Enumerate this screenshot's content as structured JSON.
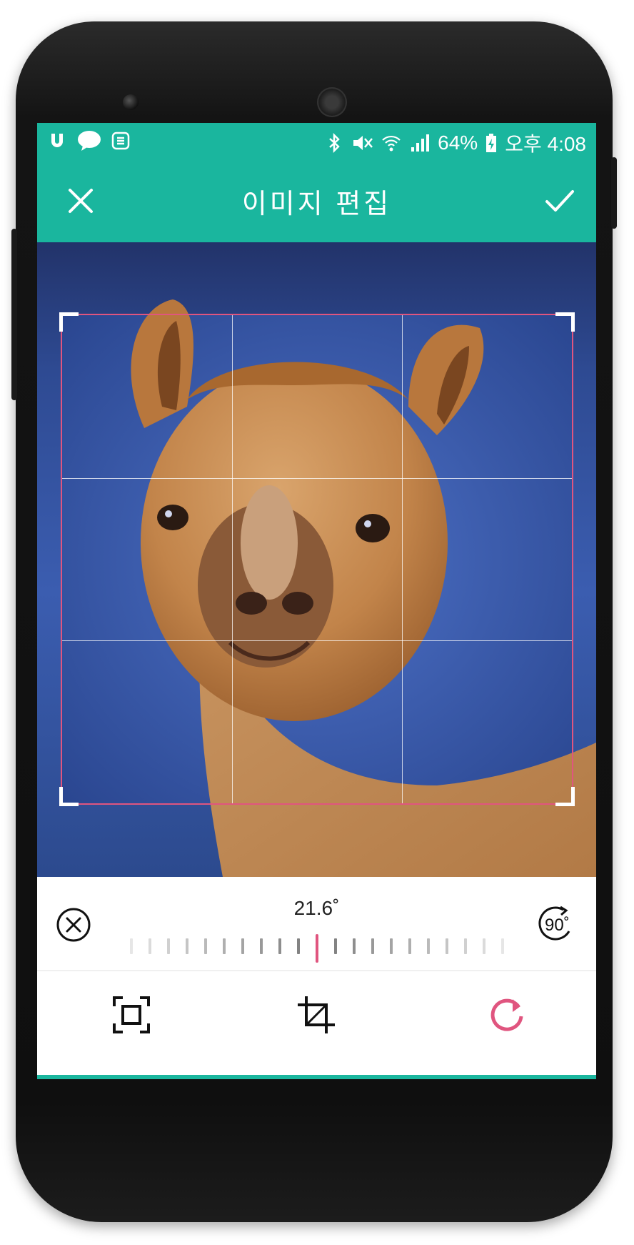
{
  "status_bar": {
    "left_icons": [
      "uplus-icon",
      "kakaotalk-icon",
      "notification-list-icon"
    ],
    "kakaotalk_label": "TALK",
    "right_icons": [
      "bluetooth-icon",
      "mute-icon",
      "wifi-icon",
      "signal-icon"
    ],
    "battery": "64%",
    "time": "오후 4:08"
  },
  "app_bar": {
    "title": "이미지 편집",
    "close_icon": "close-icon",
    "confirm_icon": "check-icon"
  },
  "editor": {
    "image_subject": "alpaca photo",
    "crop_grid": "3x3"
  },
  "rotation": {
    "angle_label": "21.6˚",
    "angle": 21.6,
    "reset_icon": "reset-circle-x-icon",
    "rotate90_label": "90˚"
  },
  "tools": [
    {
      "name": "aspect-fit-icon",
      "active": false
    },
    {
      "name": "crop-icon",
      "active": false
    },
    {
      "name": "rotate-icon",
      "active": true
    }
  ],
  "colors": {
    "primary": "#1ab69e",
    "accent": "#e0557f"
  }
}
